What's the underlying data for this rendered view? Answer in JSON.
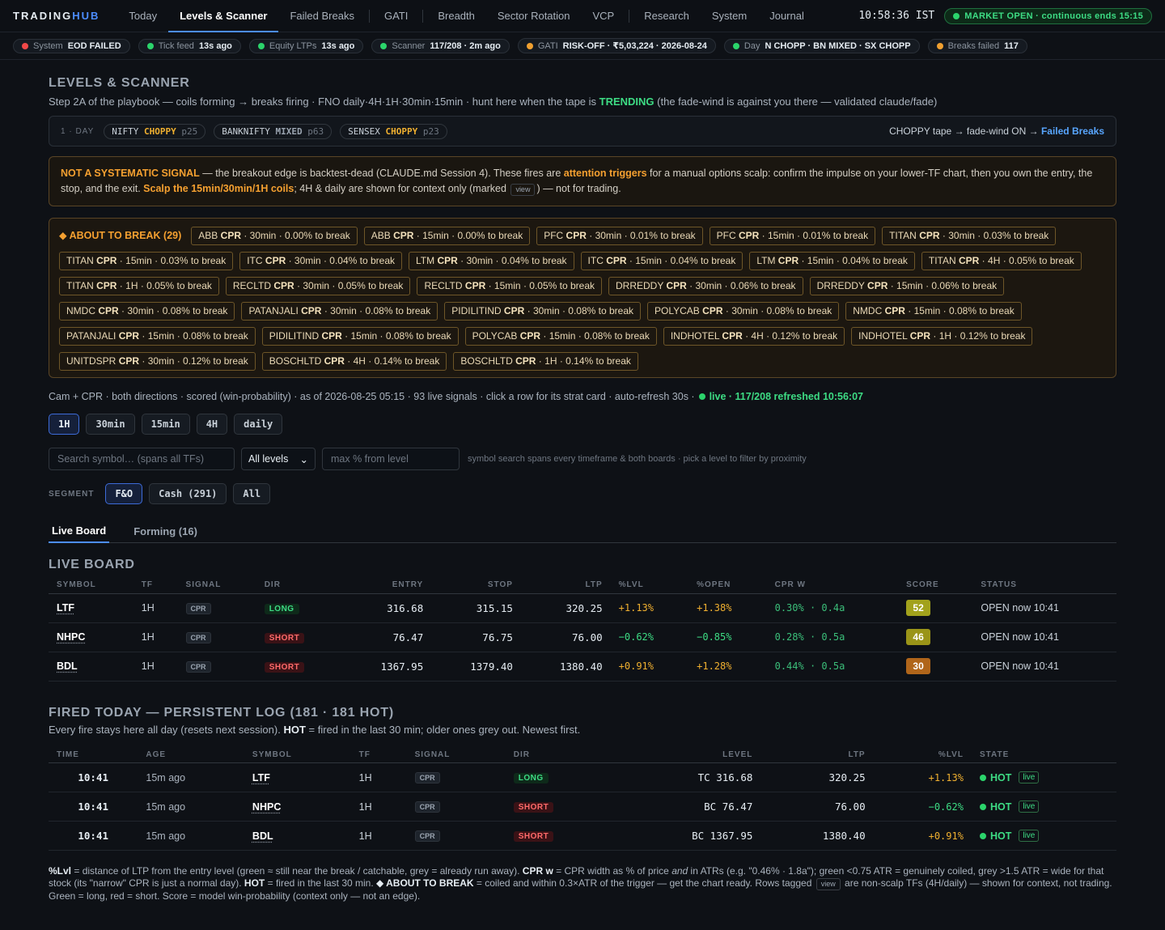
{
  "nav": {
    "logo_a": "TRADING",
    "logo_b": "HUB",
    "items": [
      "Today",
      "Levels & Scanner",
      "Failed Breaks",
      "GATI",
      "Breadth",
      "Sector Rotation",
      "VCP",
      "Research",
      "System",
      "Journal"
    ],
    "clock": "10:58:36 IST",
    "market": "MARKET OPEN · continuous ends 15:15"
  },
  "status": [
    {
      "label": "System",
      "value": "EOD FAILED",
      "color": "#f04848"
    },
    {
      "label": "Tick feed",
      "value": "13s ago",
      "color": "#2bd46b"
    },
    {
      "label": "Equity LTPs",
      "value": "13s ago",
      "color": "#2bd46b"
    },
    {
      "label": "Scanner",
      "value": "117/208 · 2m ago",
      "color": "#2bd46b"
    },
    {
      "label": "GATI",
      "value": "RISK-OFF · ₹5,03,224 · 2026-08-24",
      "color": "#f0a030"
    },
    {
      "label": "Day",
      "value": "N CHOPP · BN MIXED · SX CHOPP",
      "color": "#2bd46b"
    },
    {
      "label": "Breaks failed",
      "value": "117",
      "color": "#f0a030"
    }
  ],
  "section": {
    "title": "LEVELS & SCANNER",
    "sub_a": "Step 2A of the playbook — coils forming → breaks firing · FNO daily·4H·1H·30min·15min · hunt here when the tape is",
    "sub_trend": "TRENDING",
    "sub_b": "(the fade-wind is against you there — validated claude/fade)"
  },
  "daybox": {
    "label": "1 · DAY",
    "chips": [
      {
        "name": "NIFTY",
        "state": "CHOPPY",
        "p": "p25"
      },
      {
        "name": "BANKNIFTY",
        "state": "MIXED",
        "p": "p63"
      },
      {
        "name": "SENSEX",
        "state": "CHOPPY",
        "p": "p23"
      }
    ],
    "right_a": "CHOPPY tape → fade-wind ON →",
    "right_link": "Failed Breaks"
  },
  "warning": {
    "t1": "NOT A SYSTEMATIC SIGNAL",
    "t2": " — the breakout edge is backtest-dead (CLAUDE.md Session 4). These fires are ",
    "t3": "attention triggers",
    "t4": " for a manual options scalp: confirm the impulse on your lower-TF chart, then you own the entry, the stop, and the exit. ",
    "t5": "Scalp the 15min/30min/1H coils",
    "t6": "; 4H & daily are shown for context only (marked ",
    "view": "view",
    "t7": ") — not for trading."
  },
  "about": {
    "head": "◆ ABOUT TO BREAK (29)",
    "chips": [
      [
        "ABB",
        "CPR",
        "30min · 0.00% to break"
      ],
      [
        "ABB",
        "CPR",
        "15min · 0.00% to break"
      ],
      [
        "PFC",
        "CPR",
        "30min · 0.01% to break"
      ],
      [
        "PFC",
        "CPR",
        "15min · 0.01% to break"
      ],
      [
        "TITAN",
        "CPR",
        "30min · 0.03% to break"
      ],
      [
        "TITAN",
        "CPR",
        "15min · 0.03% to break"
      ],
      [
        "ITC",
        "CPR",
        "30min · 0.04% to break"
      ],
      [
        "LTM",
        "CPR",
        "30min · 0.04% to break"
      ],
      [
        "ITC",
        "CPR",
        "15min · 0.04% to break"
      ],
      [
        "LTM",
        "CPR",
        "15min · 0.04% to break"
      ],
      [
        "TITAN",
        "CPR",
        "4H · 0.05% to break"
      ],
      [
        "TITAN",
        "CPR",
        "1H · 0.05% to break"
      ],
      [
        "RECLTD",
        "CPR",
        "30min · 0.05% to break"
      ],
      [
        "RECLTD",
        "CPR",
        "15min · 0.05% to break"
      ],
      [
        "DRREDDY",
        "CPR",
        "30min · 0.06% to break"
      ],
      [
        "DRREDDY",
        "CPR",
        "15min · 0.06% to break"
      ],
      [
        "NMDC",
        "CPR",
        "30min · 0.08% to break"
      ],
      [
        "PATANJALI",
        "CPR",
        "30min · 0.08% to break"
      ],
      [
        "PIDILITIND",
        "CPR",
        "30min · 0.08% to break"
      ],
      [
        "POLYCAB",
        "CPR",
        "30min · 0.08% to break"
      ],
      [
        "NMDC",
        "CPR",
        "15min · 0.08% to break"
      ],
      [
        "PATANJALI",
        "CPR",
        "15min · 0.08% to break"
      ],
      [
        "PIDILITIND",
        "CPR",
        "15min · 0.08% to break"
      ],
      [
        "POLYCAB",
        "CPR",
        "15min · 0.08% to break"
      ],
      [
        "INDHOTEL",
        "CPR",
        "4H · 0.12% to break"
      ],
      [
        "INDHOTEL",
        "CPR",
        "1H · 0.12% to break"
      ],
      [
        "UNITDSPR",
        "CPR",
        "30min · 0.12% to break"
      ],
      [
        "BOSCHLTD",
        "CPR",
        "4H · 0.14% to break"
      ],
      [
        "BOSCHLTD",
        "CPR",
        "1H · 0.14% to break"
      ]
    ]
  },
  "meta": {
    "text": "Cam + CPR · both directions · scored (win-probability) · as of 2026-08-25 05:15 · 93 live signals · click a row for its strat card · auto-refresh 30s ·",
    "live": "live · 117/208 refreshed 10:56:07"
  },
  "timeframes": [
    "1H",
    "30min",
    "15min",
    "4H",
    "daily"
  ],
  "filters": {
    "search_placeholder": "Search symbol… (spans all TFs)",
    "level_value": "All levels",
    "max_placeholder": "max % from level",
    "hint": "symbol search spans every timeframe & both boards · pick a level to filter by proximity"
  },
  "segment": {
    "label": "SEGMENT",
    "options": [
      "F&O",
      "Cash (291)",
      "All"
    ]
  },
  "tabs": [
    "Live Board",
    "Forming (16)"
  ],
  "live_board": {
    "title": "LIVE BOARD",
    "columns": [
      "SYMBOL",
      "TF",
      "SIGNAL",
      "DIR",
      "ENTRY",
      "STOP",
      "LTP",
      "%LVL",
      "%OPEN",
      "CPR W",
      "SCORE",
      "STATUS"
    ],
    "rows": [
      {
        "symbol": "LTF",
        "tf": "1H",
        "signal": "CPR",
        "dir": "LONG",
        "entry": "316.68",
        "stop": "315.15",
        "ltp": "320.25",
        "lvl": "+1.13%",
        "open": "+1.38%",
        "cprw": "0.30% · 0.4a",
        "score": "52",
        "score_color": "#a2a21c",
        "status": "OPEN now 10:41"
      },
      {
        "symbol": "NHPC",
        "tf": "1H",
        "signal": "CPR",
        "dir": "SHORT",
        "entry": "76.47",
        "stop": "76.75",
        "ltp": "76.00",
        "lvl": "−0.62%",
        "open": "−0.85%",
        "cprw": "0.28% · 0.5a",
        "score": "46",
        "score_color": "#9a9418",
        "status": "OPEN now 10:41"
      },
      {
        "symbol": "BDL",
        "tf": "1H",
        "signal": "CPR",
        "dir": "SHORT",
        "entry": "1367.95",
        "stop": "1379.40",
        "ltp": "1380.40",
        "lvl": "+0.91%",
        "open": "+1.28%",
        "cprw": "0.44% · 0.5a",
        "score": "30",
        "score_color": "#b0651a",
        "status": "OPEN now 10:41"
      }
    ]
  },
  "fired": {
    "title": "FIRED TODAY — PERSISTENT LOG (181 · 181 HOT)",
    "sub_a": "Every fire stays here all day (resets next session).",
    "sub_hot": "HOT",
    "sub_b": "= fired in the last 30 min; older ones grey out. Newest first.",
    "columns": [
      "TIME",
      "AGE",
      "SYMBOL",
      "TF",
      "SIGNAL",
      "DIR",
      "LEVEL",
      "LTP",
      "%LVL",
      "STATE"
    ],
    "rows": [
      {
        "time": "10:41",
        "age": "15m ago",
        "symbol": "LTF",
        "tf": "1H",
        "signal": "CPR",
        "dir": "LONG",
        "level": "TC 316.68",
        "ltp": "320.25",
        "lvl": "+1.13%",
        "state": "HOT",
        "tag": "live"
      },
      {
        "time": "10:41",
        "age": "15m ago",
        "symbol": "NHPC",
        "tf": "1H",
        "signal": "CPR",
        "dir": "SHORT",
        "level": "BC 76.47",
        "ltp": "76.00",
        "lvl": "−0.62%",
        "state": "HOT",
        "tag": "live"
      },
      {
        "time": "10:41",
        "age": "15m ago",
        "symbol": "BDL",
        "tf": "1H",
        "signal": "CPR",
        "dir": "SHORT",
        "level": "BC 1367.95",
        "ltp": "1380.40",
        "lvl": "+0.91%",
        "state": "HOT",
        "tag": "live"
      }
    ]
  },
  "footnote": {
    "b1": "%Lvl",
    "t1": " = distance of LTP from the entry level (green ≈ still near the break / catchable, grey = already run away). ",
    "b2": "CPR w",
    "t2": " = CPR width as % of price ",
    "i1": "and",
    "t3": " in ATRs (e.g. \"0.46% · 1.8a\"); green <0.75 ATR = genuinely coiled, grey >1.5 ATR = wide for that stock (its \"narrow\" CPR is just a normal day). ",
    "b3": "HOT",
    "t4": " = fired in the last 30 min. ",
    "b4": "◆ ABOUT TO BREAK",
    "t5": " = coiled and within 0.3×ATR of the trigger — get the chart ready. Rows tagged ",
    "view": "view",
    "t6": " are non-scalp TFs (4H/daily) — shown for context, not trading. Green = long, red = short. Score = model win-probability (context only — not an edge)."
  }
}
